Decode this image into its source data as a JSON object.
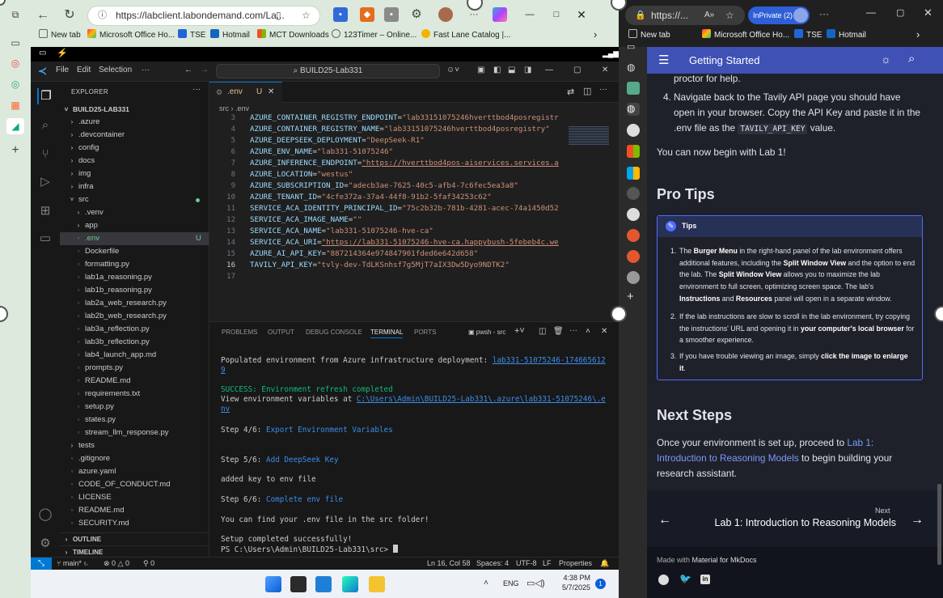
{
  "left_browser": {
    "url": "https://labclient.labondemand.com/La...",
    "favorites": [
      "New tab",
      "Microsoft Office Ho...",
      "TSE",
      "Hotmail",
      "MCT Downloads",
      "123Timer – Online...",
      "Fast Lane Catalog |..."
    ]
  },
  "vscode": {
    "menu": [
      "File",
      "Edit",
      "Selection",
      "···"
    ],
    "command_center": "BUILD25-Lab331",
    "explorer_title": "EXPLORER",
    "workspace": "BUILD25-LAB331",
    "tree": [
      {
        "name": ".azure",
        "kind": "folder",
        "indent": 1
      },
      {
        "name": ".devcontainer",
        "kind": "folder",
        "indent": 1
      },
      {
        "name": "config",
        "kind": "folder",
        "indent": 1
      },
      {
        "name": "docs",
        "kind": "folder",
        "indent": 1
      },
      {
        "name": "img",
        "kind": "folder",
        "indent": 1
      },
      {
        "name": "infra",
        "kind": "folder",
        "indent": 1
      },
      {
        "name": "src",
        "kind": "folder-open",
        "indent": 1
      },
      {
        "name": ".venv",
        "kind": "folder",
        "indent": 2
      },
      {
        "name": "app",
        "kind": "folder",
        "indent": 2
      },
      {
        "name": ".env",
        "kind": "file",
        "indent": 2,
        "badge": "U"
      },
      {
        "name": "Dockerfile",
        "kind": "file",
        "indent": 2
      },
      {
        "name": "formatting.py",
        "kind": "file",
        "indent": 2
      },
      {
        "name": "lab1a_reasoning.py",
        "kind": "file",
        "indent": 2
      },
      {
        "name": "lab1b_reasoning.py",
        "kind": "file",
        "indent": 2
      },
      {
        "name": "lab2a_web_research.py",
        "kind": "file",
        "indent": 2
      },
      {
        "name": "lab2b_web_research.py",
        "kind": "file",
        "indent": 2
      },
      {
        "name": "lab3a_reflection.py",
        "kind": "file",
        "indent": 2
      },
      {
        "name": "lab3b_reflection.py",
        "kind": "file",
        "indent": 2
      },
      {
        "name": "lab4_launch_app.md",
        "kind": "file",
        "indent": 2
      },
      {
        "name": "prompts.py",
        "kind": "file",
        "indent": 2
      },
      {
        "name": "README.md",
        "kind": "file",
        "indent": 2
      },
      {
        "name": "requirements.txt",
        "kind": "file",
        "indent": 2
      },
      {
        "name": "setup.py",
        "kind": "file",
        "indent": 2
      },
      {
        "name": "states.py",
        "kind": "file",
        "indent": 2
      },
      {
        "name": "stream_llm_response.py",
        "kind": "file",
        "indent": 2
      },
      {
        "name": "tests",
        "kind": "folder",
        "indent": 1
      },
      {
        "name": ".gitignore",
        "kind": "file",
        "indent": 1
      },
      {
        "name": "azure.yaml",
        "kind": "file",
        "indent": 1
      },
      {
        "name": "CODE_OF_CONDUCT.md",
        "kind": "file",
        "indent": 1
      },
      {
        "name": "LICENSE",
        "kind": "file",
        "indent": 1
      },
      {
        "name": "README.md",
        "kind": "file",
        "indent": 1
      },
      {
        "name": "SECURITY.md",
        "kind": "file",
        "indent": 1
      }
    ],
    "outline": "OUTLINE",
    "timeline": "TIMELINE",
    "tab_name": ".env",
    "tab_badge": "U",
    "breadcrumb": "src  ›  .env",
    "code": [
      {
        "n": "3",
        "k": "AZURE_CONTAINER_REGISTRY_ENDPOINT",
        "v": "\"lab33151075246hverttbod4posregistr"
      },
      {
        "n": "4",
        "k": "AZURE_CONTAINER_REGISTRY_NAME",
        "v": "\"lab33151075246hverttbod4posregistry\""
      },
      {
        "n": "5",
        "k": "AZURE_DEEPSEEK_DEPLOYMENT",
        "v": "\"DeepSeek-R1\""
      },
      {
        "n": "6",
        "k": "AZURE_ENV_NAME",
        "v": "\"lab331-51075246\""
      },
      {
        "n": "7",
        "k": "AZURE_INFERENCE_ENDPOINT",
        "v": "\"https://hverttbod4pos-aiservices.services.a"
      },
      {
        "n": "8",
        "k": "AZURE_LOCATION",
        "v": "\"westus\""
      },
      {
        "n": "9",
        "k": "AZURE_SUBSCRIPTION_ID",
        "v": "\"adecb3ae-7625-40c5-afb4-7c6fec5ea3a8\""
      },
      {
        "n": "10",
        "k": "AZURE_TENANT_ID",
        "v": "\"4cfe372a-37a4-44f8-91b2-5faf34253c62\""
      },
      {
        "n": "11",
        "k": "SERVICE_ACA_IDENTITY_PRINCIPAL_ID",
        "v": "\"75c2b32b-781b-4281-acec-74a1450d52"
      },
      {
        "n": "12",
        "k": "SERVICE_ACA_IMAGE_NAME",
        "v": "\"\""
      },
      {
        "n": "13",
        "k": "SERVICE_ACA_NAME",
        "v": "\"lab331-51075246-hve-ca\""
      },
      {
        "n": "14",
        "k": "SERVICE_ACA_URI",
        "v": "\"https://lab331-51075246-hve-ca.happybush-5febeb4c.we"
      },
      {
        "n": "15",
        "k": "AZURE_AI_API_KEY",
        "v": "\"887214364e974847901fded6e642d658\""
      },
      {
        "n": "16",
        "k": "TAVILY_API_KEY",
        "v": "\"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\""
      },
      {
        "n": "17",
        "k": "",
        "v": ""
      }
    ],
    "panel_tabs": [
      "PROBLEMS",
      "OUTPUT",
      "DEBUG CONSOLE",
      "TERMINAL",
      "PORTS"
    ],
    "terminal_name": "pwsh - src",
    "terminal": {
      "l1": "Populated environment from Azure infrastructure deployment: ",
      "l1_link": "lab331-51075246-174665612",
      "l2_link": "9",
      "l3": "SUCCESS: Environment refresh completed",
      "l4": "View environment variables at ",
      "l4_link": "C:\\Users\\Admin\\BUILD25-Lab331\\.azure\\lab331-51075246\\.e",
      "l5_link": "nv",
      "l6a": "Step 4/6: ",
      "l6b": "Export Environment Variables",
      "l7a": "Step 5/6: ",
      "l7b": "Add DeepSeek Key",
      "l8": "added key to env file",
      "l9a": "Step 6/6: ",
      "l9b": "Complete env file",
      "l10": "You can find your .env file in the src folder!",
      "l11": "Setup completed successfully!",
      "l12": "PS C:\\Users\\Admin\\BUILD25-Lab331\\src> "
    },
    "status": {
      "branch": "main*",
      "errors": "0",
      "warnings": "0",
      "ports": "0",
      "cursor": "Ln 16, Col 58",
      "spaces": "Spaces: 4",
      "encoding": "UTF-8",
      "eol": "LF",
      "props": "Properties"
    }
  },
  "taskbar": {
    "lang": "ENG",
    "time": "4:38 PM",
    "date": "5/7/2025",
    "badge": "1"
  },
  "right_browser": {
    "url": "https://...",
    "inprivate": "InPrivate (2)",
    "favorites": [
      "New tab",
      "Microsoft Office Ho...",
      "TSE",
      "Hotmail"
    ],
    "site_title": "Getting Started",
    "proctor": "proctor for help.",
    "step4_pre": "Navigate back to the Tavily API page you should have open in your browser. Copy the API Key and paste it in the .env file as the ",
    "step4_code": "TAVILY_API_KEY",
    "step4_post": " value.",
    "begin": "You can now begin with Lab 1!",
    "pro_tips": "Pro Tips",
    "tips_title": "Tips",
    "next_steps": "Next Steps",
    "next_pre": "Once your environment is set up, proceed to ",
    "next_link": "Lab 1: Introduction to Reasoning Models",
    "next_post": " to begin building your research assistant.",
    "next_label": "Next",
    "next_title": "Lab 1: Introduction to Reasoning Models",
    "made_with": "Made with ",
    "made_link": "Material for MkDocs"
  }
}
